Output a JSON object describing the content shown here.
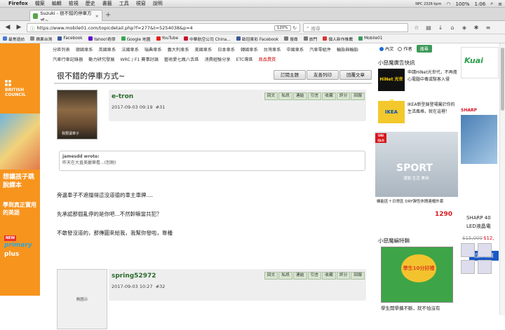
{
  "menubar": {
    "app": "Firefox",
    "items": [
      "檔案",
      "編輯",
      "檢視",
      "歷史",
      "書籤",
      "工具",
      "視窗",
      "說明"
    ],
    "network": "NPC 2326 kpm",
    "battery": "100%",
    "time": "1:06"
  },
  "tab": {
    "title": "Suzuki - 很不錯的停車方式~",
    "close": "×",
    "new": "+"
  },
  "nav": {
    "url": "https://www.mobile01.com/topicdetail.php?f=277&t=5254038&p=4",
    "zoom": "120%",
    "search_placeholder": "搜尋"
  },
  "bookmarks": [
    {
      "label": "最常造訪",
      "color": "#4a7bd0"
    },
    {
      "label": "蘋果台灣",
      "color": "#888"
    },
    {
      "label": "Facebook",
      "color": "#3b5998"
    },
    {
      "label": "Yahoo!奇摩",
      "color": "#5f01d1"
    },
    {
      "label": "Google 地圖",
      "color": "#34a853"
    },
    {
      "label": "YouTube",
      "color": "#e62117"
    },
    {
      "label": "中華航空公司 China...",
      "color": "#c8102e"
    },
    {
      "label": "歐冠東彩 Facebook",
      "color": "#3b5998"
    },
    {
      "label": "搜尋",
      "color": "#777"
    },
    {
      "label": "旅門",
      "color": "#777"
    },
    {
      "label": "個人新作推薦",
      "color": "#d33"
    },
    {
      "label": "Mobile01",
      "color": "#3e9a5a"
    }
  ],
  "leftad": {
    "brand": "BRITISH COUNCIL",
    "line1": "想讓孩子跳脫課本",
    "line2": "學到真正實用的英語",
    "new": "NEW",
    "primary": "primary",
    "plus": "plus"
  },
  "forum_menu": [
    "分區列表",
    "德國車系",
    "英國車系",
    "法國車系",
    "瑞典車系",
    "義大利車系",
    "美國車系",
    "日本車系",
    "韓國車系",
    "台灣車系",
    "中國車系",
    "汽車零組件",
    "輪胎與輪胎",
    "汽車行車記錄器",
    "動力研究發展",
    "WRC / F1 賽事討論",
    "藝術愛七瘋八舌區",
    "消費經驗分享",
    "ETC專區",
    "商品異質"
  ],
  "topic": {
    "title": "很不錯的停車方式~",
    "buttons": [
      "訂閱主題",
      "友善列印",
      "回覆文章"
    ]
  },
  "post_buttons": [
    "回文",
    "私訊",
    "連結",
    "引言",
    "收藏",
    "評分",
    "回報"
  ],
  "posts": [
    {
      "user": "e-tron",
      "date": "2017-09-03 09:19",
      "num": "#31",
      "avatar_caption": "我要讓車子"
    },
    {
      "user": "spring52972",
      "date": "2017-09-03 10:27",
      "num": "#32",
      "avatar_text": "無圖示"
    }
  ],
  "quote": {
    "header": "jamesdd wrote:",
    "text": "昨天在大直美麗華看...(恕刪)"
  },
  "body": [
    "旁邊車子不遮擋得這沒道德的車主車牌....",
    "先承認那個亂停的是你吧...不然幹嘛當共犯？",
    "不敢發沒道的，那傳圖來給我，我幫你發啦，靠種"
  ],
  "sidebar": {
    "search_opts": [
      "內文",
      "作者"
    ],
    "search_btn": "搜尋",
    "ads_title": "小惡魔廣告快訊",
    "ads": [
      {
        "img": "HiNet 光世代",
        "text": "申請HiNet光世代，不再擔心電腦中毒或駭客入侵"
      },
      {
        "img": "IKEA",
        "text": "IKEA新型錄登場屬於你的生活風格，就在這裡！"
      }
    ],
    "uniqlo_tag": "UNI QLO",
    "uniqlo_sport": "SPORT",
    "uniqlo_sub": "運動·生活 兼具",
    "uniqlo_bottom": "機能區＋日常區 DRY彈性休閒連帽外套",
    "uniqlo_price": "1290",
    "editor_title": "小惡魔編特輯",
    "editor_img": "學生10分好禮",
    "editor_caption": "學生開學攜不斷，就不怕沒有"
  },
  "rightad": {
    "kuai": "Kuai",
    "sharp": "SHARP",
    "name1": "SHARP 40",
    "name2": "LED液晶電",
    "old": "$15,000",
    "new": "$12,",
    "buy": "立即購買"
  }
}
